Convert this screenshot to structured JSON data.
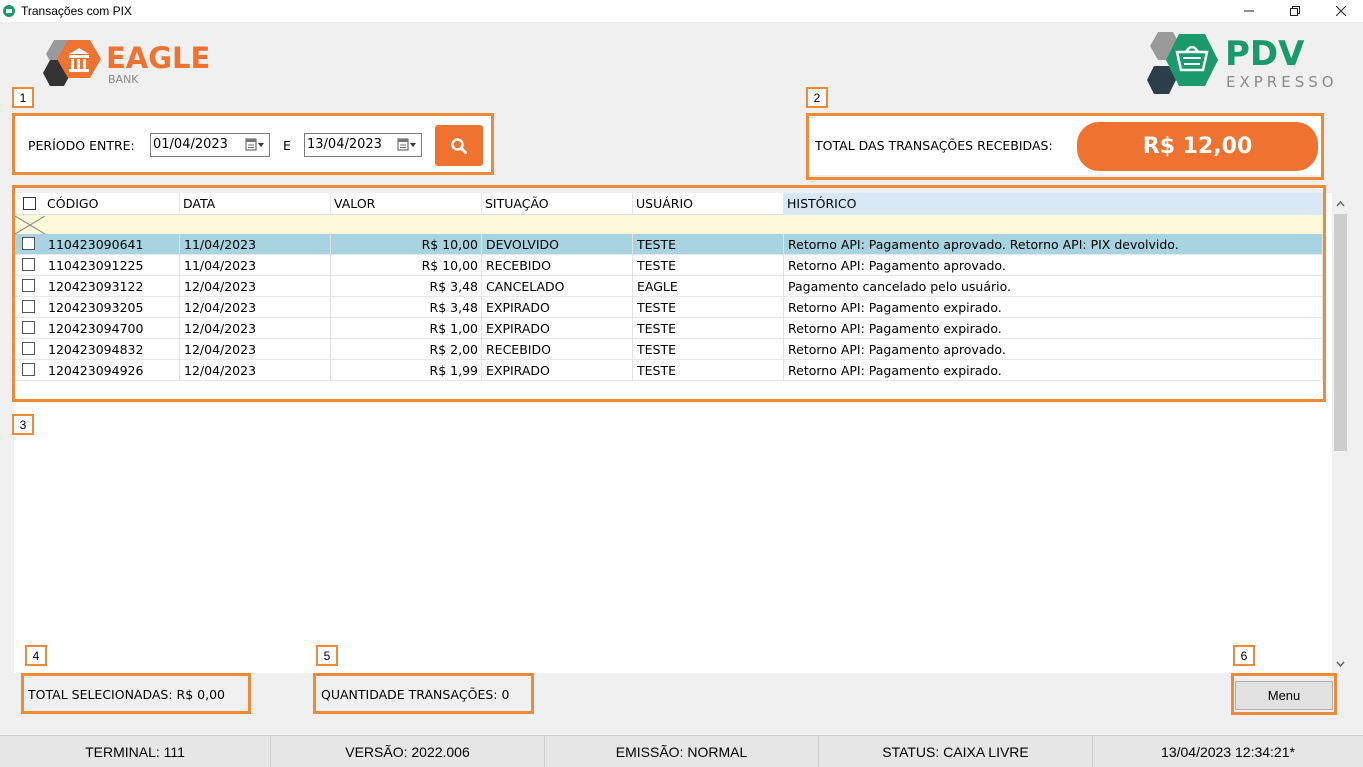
{
  "window": {
    "title": "Transações com PIX"
  },
  "logos": {
    "left": {
      "name": "EAGLE",
      "sub": "BANK"
    },
    "right": {
      "name": "PDV",
      "sub": "EXPRESSO"
    }
  },
  "tags": [
    "1",
    "2",
    "3",
    "4",
    "5",
    "6"
  ],
  "filter": {
    "period_label": "PERÍODO ENTRE:",
    "start_date": "01/04/2023",
    "and_label": "E",
    "end_date": "13/04/2023"
  },
  "summary": {
    "total_label": "TOTAL DAS TRANSAÇÕES RECEBIDAS:",
    "total_value": "R$ 12,00"
  },
  "grid": {
    "columns": [
      "CÓDIGO",
      "DATA",
      "VALOR",
      "SITUAÇÃO",
      "USUÁRIO",
      "HISTÓRICO"
    ],
    "rows": [
      {
        "codigo": "110423090641",
        "data": "11/04/2023",
        "valor": "R$ 10,00",
        "situacao": "DEVOLVIDO",
        "usuario": "TESTE",
        "historico": "Retorno API: Pagamento aprovado. Retorno API: PIX devolvido.",
        "selected": true
      },
      {
        "codigo": "110423091225",
        "data": "11/04/2023",
        "valor": "R$ 10,00",
        "situacao": "RECEBIDO",
        "usuario": "TESTE",
        "historico": "Retorno API: Pagamento aprovado."
      },
      {
        "codigo": "120423093122",
        "data": "12/04/2023",
        "valor": "R$ 3,48",
        "situacao": "CANCELADO",
        "usuario": "EAGLE",
        "historico": "Pagamento cancelado pelo usuário."
      },
      {
        "codigo": "120423093205",
        "data": "12/04/2023",
        "valor": "R$ 3,48",
        "situacao": "EXPIRADO",
        "usuario": "TESTE",
        "historico": "Retorno API: Pagamento expirado."
      },
      {
        "codigo": "120423094700",
        "data": "12/04/2023",
        "valor": "R$ 1,00",
        "situacao": "EXPIRADO",
        "usuario": "TESTE",
        "historico": "Retorno API: Pagamento expirado."
      },
      {
        "codigo": "120423094832",
        "data": "12/04/2023",
        "valor": "R$ 2,00",
        "situacao": "RECEBIDO",
        "usuario": "TESTE",
        "historico": "Retorno API: Pagamento aprovado."
      },
      {
        "codigo": "120423094926",
        "data": "12/04/2023",
        "valor": "R$ 1,99",
        "situacao": "EXPIRADO",
        "usuario": "TESTE",
        "historico": "Retorno API: Pagamento expirado."
      }
    ]
  },
  "footer": {
    "selected_total": "TOTAL SELECIONADAS: R$ 0,00",
    "quantity": "QUANTIDADE TRANSAÇÕES: 0",
    "menu_label": "Menu"
  },
  "statusbar": {
    "terminal": "TERMINAL: 111",
    "version": "VERSÃO: 2022.006",
    "emission": "EMISSÃO: NORMAL",
    "status": "STATUS: CAIXA LIVRE",
    "datetime": "13/04/2023 12:34:21*"
  },
  "colors": {
    "accent": "#f07230",
    "highlight_frame": "#ee8a3a",
    "selected_row": "#a8d3e0",
    "pdv_green": "#1a9a6c",
    "dark_hex": "#2c3e4a"
  }
}
